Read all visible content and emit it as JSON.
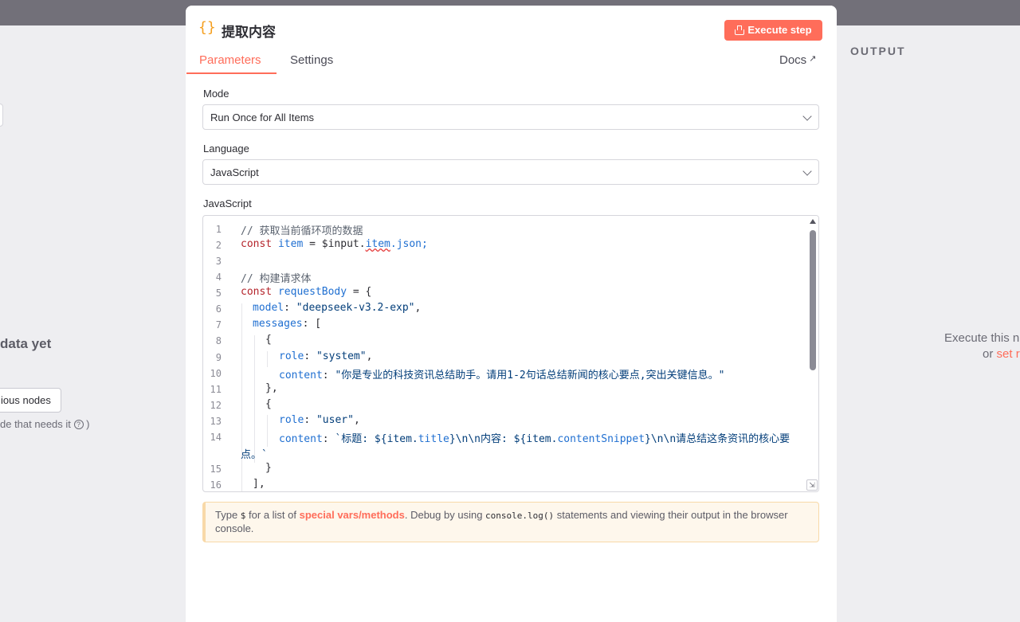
{
  "left_panel": {
    "no_data_title": "data yet",
    "prev_nodes_button": "ious nodes",
    "hint_text": "de that needs it",
    "hint_suffix": ")"
  },
  "output_panel": {
    "label": "OUTPUT",
    "hint_line1": "Execute this n",
    "hint_line2_prefix": "or",
    "hint_line2_link": "set r"
  },
  "node": {
    "icon_glyph": "{}",
    "title": "提取内容",
    "execute_label": "Execute step"
  },
  "tabs": [
    {
      "label": "Parameters",
      "active": true
    },
    {
      "label": "Settings",
      "active": false
    }
  ],
  "docs_label": "Docs",
  "fields": {
    "mode": {
      "label": "Mode",
      "value": "Run Once for All Items"
    },
    "language": {
      "label": "Language",
      "value": "JavaScript"
    },
    "code_label": "JavaScript"
  },
  "code": {
    "line_numbers": [
      "1",
      "2",
      "3",
      "4",
      "5",
      "6",
      "7",
      "8",
      "9",
      "10",
      "11",
      "12",
      "13",
      "14",
      "15",
      "16"
    ],
    "l1": "// 获取当前循环项的数据",
    "l2_kw": "const",
    "l2_var": "item",
    "l2_rest1": " = $input.",
    "l2_item": "item",
    "l2_rest2": ".json;",
    "l4": "// 构建请求体",
    "l5_kw": "const",
    "l5_var": "requestBody",
    "l5_rest": " = {",
    "l6_key": "model",
    "l6_val": "\"deepseek-v3.2-exp\"",
    "l7_key": "messages",
    "l7_rest": ": [",
    "l8": "{",
    "l9_key": "role",
    "l9_val": "\"system\"",
    "l10_key": "content",
    "l10_val": "\"你是专业的科技资讯总结助手。请用1-2句话总结新闻的核心要点,突出关键信息。\"",
    "l11": "},",
    "l12": "{",
    "l13_key": "role",
    "l13_val": "\"user\"",
    "l14_key": "content",
    "l14_a": "`标题: ${item.",
    "l14_title": "title",
    "l14_b": "}\\n\\n内容: ${item.",
    "l14_snip": "contentSnippet",
    "l14_c": "}\\n\\n请总结这条资讯的核心要",
    "l14_wrap": "点。`",
    "l15": "}",
    "l16": "],"
  },
  "notice": {
    "p1": "Type ",
    "dollar": "$",
    "p2": " for a list of ",
    "link": "special vars/methods",
    "p3": ". Debug by using ",
    "code": "console.log()",
    "p4": " statements and viewing their output in the browser console."
  },
  "colors": {
    "accent": "#ff6d5a",
    "node_icon": "#f59f1f",
    "topbar": "#727079"
  }
}
